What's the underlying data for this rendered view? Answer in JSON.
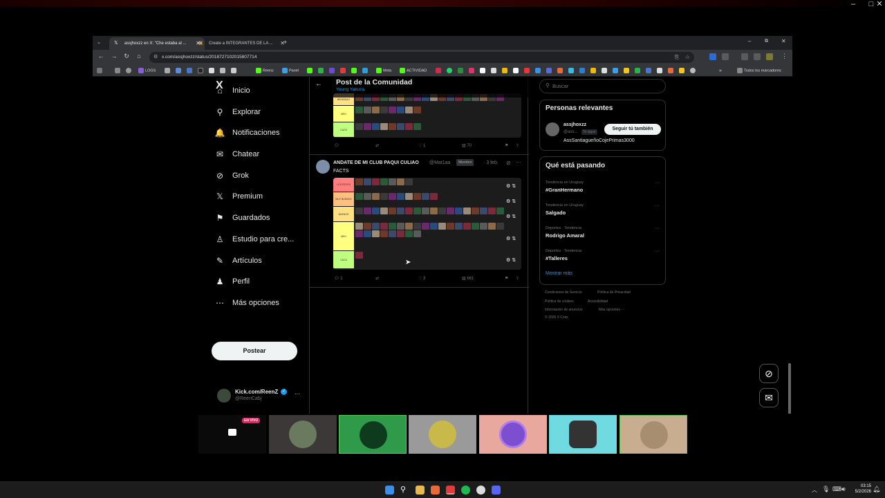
{
  "browser": {
    "tabs": [
      {
        "title": "assjhoxzz en X: \"Che estaba al ...",
        "active": true
      },
      {
        "title": "Create a INTEGRANTES DE LA ...",
        "active": false
      }
    ],
    "url": "x.com/assjhoxzz/status/2018727102015807714",
    "bookmarks": [
      "LOGS",
      "Reenz",
      "Panel",
      "Meta",
      "ACTIVIDAD"
    ],
    "all_bookmarks_label": "Todos los marcadores"
  },
  "sidebar": {
    "logo": "X",
    "items": [
      {
        "label": "Inicio",
        "icon": "home-icon",
        "glyph": "⌂"
      },
      {
        "label": "Explorar",
        "icon": "search-icon",
        "glyph": "⚲"
      },
      {
        "label": "Notificaciones",
        "icon": "bell-icon",
        "glyph": "🔔"
      },
      {
        "label": "Chatear",
        "icon": "mail-icon",
        "glyph": "✉"
      },
      {
        "label": "Grok",
        "icon": "grok-icon",
        "glyph": "⊘"
      },
      {
        "label": "Premium",
        "icon": "x-icon",
        "glyph": "𝕏"
      },
      {
        "label": "Guardados",
        "icon": "bookmark-icon",
        "glyph": "⚑"
      },
      {
        "label": "Estudio para cre...",
        "icon": "studio-icon",
        "glyph": "♙"
      },
      {
        "label": "Artículos",
        "icon": "article-icon",
        "glyph": "✎"
      },
      {
        "label": "Perfil",
        "icon": "person-icon",
        "glyph": "♟"
      },
      {
        "label": "Más opciones",
        "icon": "more-icon",
        "glyph": "⋯"
      }
    ],
    "post_button": "Postear",
    "account": {
      "name": "Kick.com/ReenZ",
      "handle": "@ReenCabj",
      "more": "···"
    }
  },
  "header": {
    "title": "Post de la Comunidad",
    "subtitle": "Young Yakuza"
  },
  "post1": {
    "tier_labels": [
      "BIENÍSIMO",
      "MEH",
      "CACA"
    ],
    "tier_colors": [
      "#ffdf80",
      "#ffff7f",
      "#bfff7f"
    ],
    "actions": {
      "replies": "",
      "reposts": "",
      "likes": "1",
      "views": "70"
    }
  },
  "post2": {
    "author": "ANDATE DE MI CLUB PAQUI CULIAO",
    "handle": "@Mat1aa",
    "badge": "Miembro",
    "date": "· 3 feb.",
    "text": "FACTS",
    "tier_labels": [
      "LOS REYES",
      "MUY BUENOS",
      "BUENOS",
      "MEH",
      "CACA"
    ],
    "tier_colors": [
      "#ff7f7f",
      "#ffbf7f",
      "#ffdf7f",
      "#ffff7f",
      "#bfff7f"
    ],
    "actions": {
      "replies": "1",
      "reposts": "",
      "likes": "3",
      "views": "661"
    }
  },
  "right": {
    "search_placeholder": "Buscar",
    "relevant": {
      "title": "Personas relevantes",
      "name": "assjhoxzz",
      "handle": "@ass...",
      "follows_you": "Te sigue",
      "follow_button": "Seguir tú también",
      "bio": "AssSantiagueñoCojePrimas3000"
    },
    "trends": {
      "title": "Qué está pasando",
      "items": [
        {
          "meta": "Tendencia en Uruguay",
          "name": "#GranHermano"
        },
        {
          "meta": "Tendencia en Uruguay",
          "name": "Salgado"
        },
        {
          "meta": "Deportes · Tendencia",
          "name": "Rodrigo Amaral"
        },
        {
          "meta": "Deportes · Tendencia",
          "name": "#Talleres"
        }
      ],
      "show_more": "Mostrar más"
    },
    "footer": [
      "Condiciones de Servicio",
      "Política de Privacidad",
      "Política de cookies",
      "Accesibilidad",
      "Información de anuncios",
      "Más opciones ···",
      "© 2026 X Corp."
    ]
  },
  "stream": {
    "live_badge": "EN VIVO"
  },
  "taskbar": {
    "time": "03:15",
    "date": "5/2/2026"
  }
}
